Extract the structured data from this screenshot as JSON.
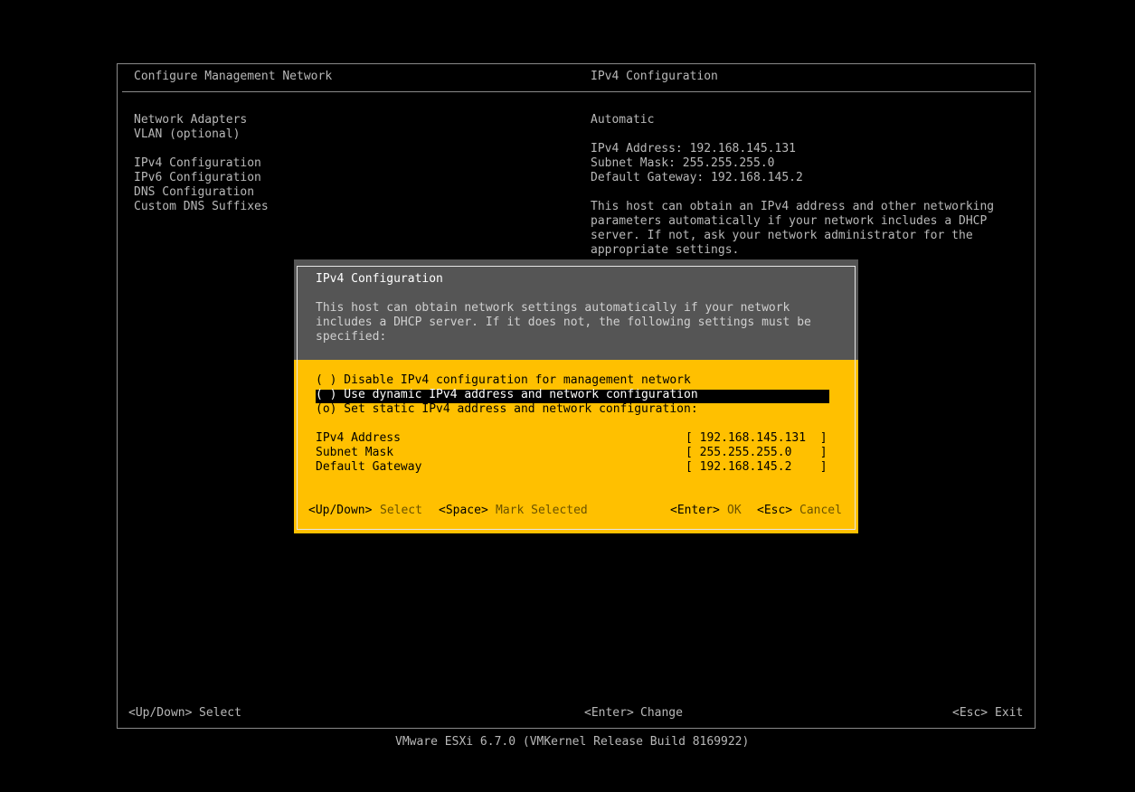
{
  "header": {
    "left_title": "Configure Management Network",
    "right_title": "IPv4 Configuration"
  },
  "menu": {
    "items": [
      {
        "label": "Network Adapters"
      },
      {
        "label": "VLAN (optional)"
      },
      {
        "label": "IPv4 Configuration"
      },
      {
        "label": "IPv6 Configuration"
      },
      {
        "label": "DNS Configuration"
      },
      {
        "label": "Custom DNS Suffixes"
      }
    ]
  },
  "info": {
    "mode": "Automatic",
    "ipv4_line": "IPv4 Address: 192.168.145.131",
    "subnet_line": "Subnet Mask: 255.255.255.0",
    "gateway_line": "Default Gateway: 192.168.145.2",
    "desc": [
      "This host can obtain an IPv4 address and other networking",
      "parameters automatically if your network includes a DHCP",
      "server. If not, ask your network administrator for the",
      "appropriate settings."
    ]
  },
  "dialog": {
    "title": "IPv4 Configuration",
    "desc": [
      "This host can obtain network settings automatically if your network",
      "includes a DHCP server. If it does not, the following settings must be",
      "specified:"
    ],
    "options": [
      {
        "label": "( ) Disable IPv4 configuration for management network",
        "selected": false
      },
      {
        "label": "( ) Use dynamic IPv4 address and network configuration",
        "selected": true
      },
      {
        "label": "(o) Set static IPv4 address and network configuration:",
        "selected": false
      }
    ],
    "fields": [
      {
        "label": "IPv4 Address",
        "value": "[ 192.168.145.131  ]"
      },
      {
        "label": "Subnet Mask",
        "value": "[ 255.255.255.0    ]"
      },
      {
        "label": "Default Gateway",
        "value": "[ 192.168.145.2    ]"
      }
    ],
    "keys": {
      "updown_key": "<Up/Down>",
      "updown_label": "Select",
      "space_key": "<Space>",
      "space_label": "Mark Selected",
      "enter_key": "<Enter>",
      "enter_label": "OK",
      "esc_key": "<Esc>",
      "esc_label": "Cancel"
    }
  },
  "footer": {
    "left_key": "<Up/Down>",
    "left_label": "Select",
    "mid_key": "<Enter>",
    "mid_label": "Change",
    "right_key": "<Esc>",
    "right_label": "Exit",
    "version": "VMware ESXi 6.7.0 (VMKernel Release Build 8169922)"
  },
  "colors": {
    "dialog_bg": "#ffc000",
    "dialog_header_bg": "#555555",
    "screen_bg": "#000000"
  }
}
